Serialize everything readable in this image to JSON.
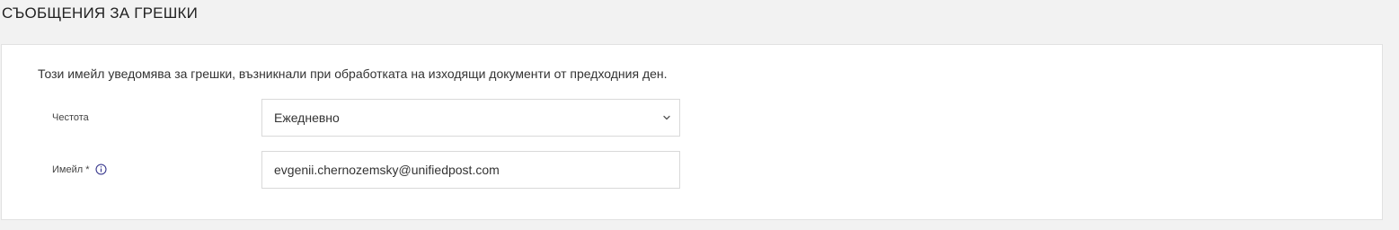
{
  "section": {
    "title": "СЪОБЩЕНИЯ ЗА ГРЕШКИ"
  },
  "card": {
    "description": "Този имейл уведомява за грешки, възникнали при обработката на изходящи документи от предходния ден.",
    "frequency": {
      "label": "Честота",
      "selected_value": "Ежедневно",
      "icon": "chevron-down-icon"
    },
    "email": {
      "label": "Имейл *",
      "value": "evgenii.chernozemsky@unifiedpost.com",
      "icon": "info-icon"
    }
  },
  "colors": {
    "page_background": "#f2f2f2",
    "card_background": "#ffffff",
    "info_icon": "#3b3b8f"
  }
}
